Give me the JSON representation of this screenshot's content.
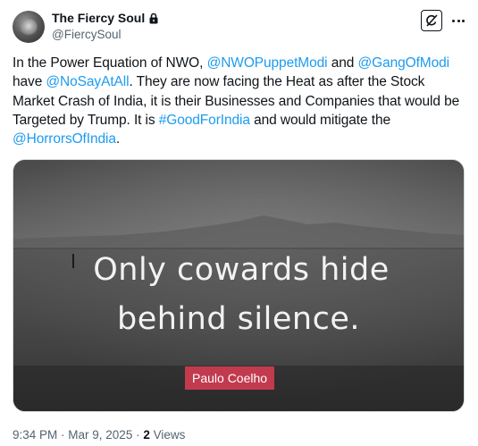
{
  "author": {
    "display_name": "The Fiercy Soul",
    "handle": "@FiercySoul",
    "protected_icon": "lock-icon"
  },
  "header_actions": {
    "grok_icon": "grok-icon",
    "more_icon": "more-horizontal-icon"
  },
  "tweet": {
    "t1": "In the Power Equation of NWO, ",
    "m1": "@NWOPuppetModi",
    "t2": " and ",
    "m2": "@GangOfModi",
    "t3": " have ",
    "m3": "@NoSayAtAll",
    "t4": ". They are now facing the Heat as after the Stock Market Crash of India, it is their Businesses and Companies that would be Targeted by Trump. It is ",
    "h1": "#GoodForIndia",
    "t5": " and would mitigate the ",
    "m4": "@HorrorsOfIndia",
    "t6": "."
  },
  "media": {
    "quote_line1": "Only cowards hide",
    "quote_line2": "behind silence.",
    "quote_author": "Paulo Coelho",
    "badge_color": "#c23a4e"
  },
  "meta": {
    "time": "9:34 PM",
    "sep1": " · ",
    "date": "Mar 9, 2025",
    "sep2": " · ",
    "views_count": "2",
    "views_label": " Views"
  },
  "colors": {
    "link": "#1d9bf0",
    "text": "#0f1419",
    "secondary": "#536471"
  }
}
